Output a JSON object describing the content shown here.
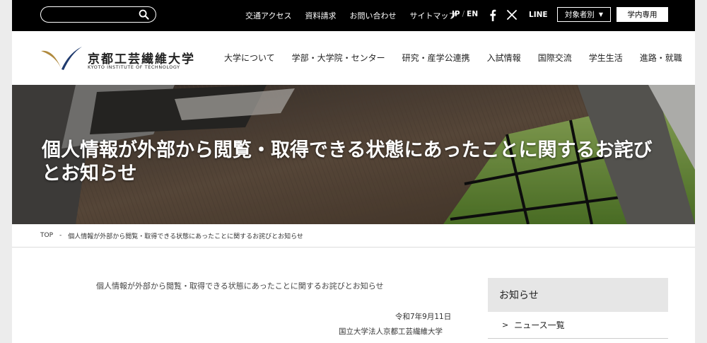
{
  "topbar": {
    "search_placeholder": "",
    "links": [
      "交通アクセス",
      "資料請求",
      "お問い合わせ",
      "サイトマップ"
    ],
    "lang_jp": "JP",
    "lang_sep": "/",
    "lang_en": "EN",
    "line_label": "LINE",
    "target_label": "対象者別",
    "target_arrow": "▼",
    "internal_label": "学内専用"
  },
  "header": {
    "logo_jp": "京都工芸繊維大学",
    "logo_en": "KYOTO INSTITUTE OF TECHNOLOGY",
    "nav": [
      "大学について",
      "学部・大学院・センター",
      "研究・産学公連携",
      "入試情報",
      "国際交流",
      "学生生活",
      "進路・就職"
    ]
  },
  "hero": {
    "title": "個人情報が外部から閲覧・取得できる状態にあったことに関するお詫びとお知らせ"
  },
  "breadcrumb": {
    "home": "TOP",
    "separator": "-",
    "current": "個人情報が外部から閲覧・取得できる状態にあったことに関するお詫びとお知らせ"
  },
  "content": {
    "heading": "個人情報が外部から閲覧・取得できる状態にあったことに関するお詫びとお知らせ",
    "date": "令和7年9月11日",
    "org": "国立大学法人京都工芸繊維大学"
  },
  "sidebar": {
    "title": "お知らせ",
    "items": [
      {
        "chevron": ">",
        "label": "ニュース一覧"
      }
    ]
  },
  "colors": {
    "topbar_bg": "#000000",
    "logo_gold": "#b08a3e",
    "logo_navy": "#1f3a6e",
    "sidebar_head_bg": "#e6e6e6"
  }
}
